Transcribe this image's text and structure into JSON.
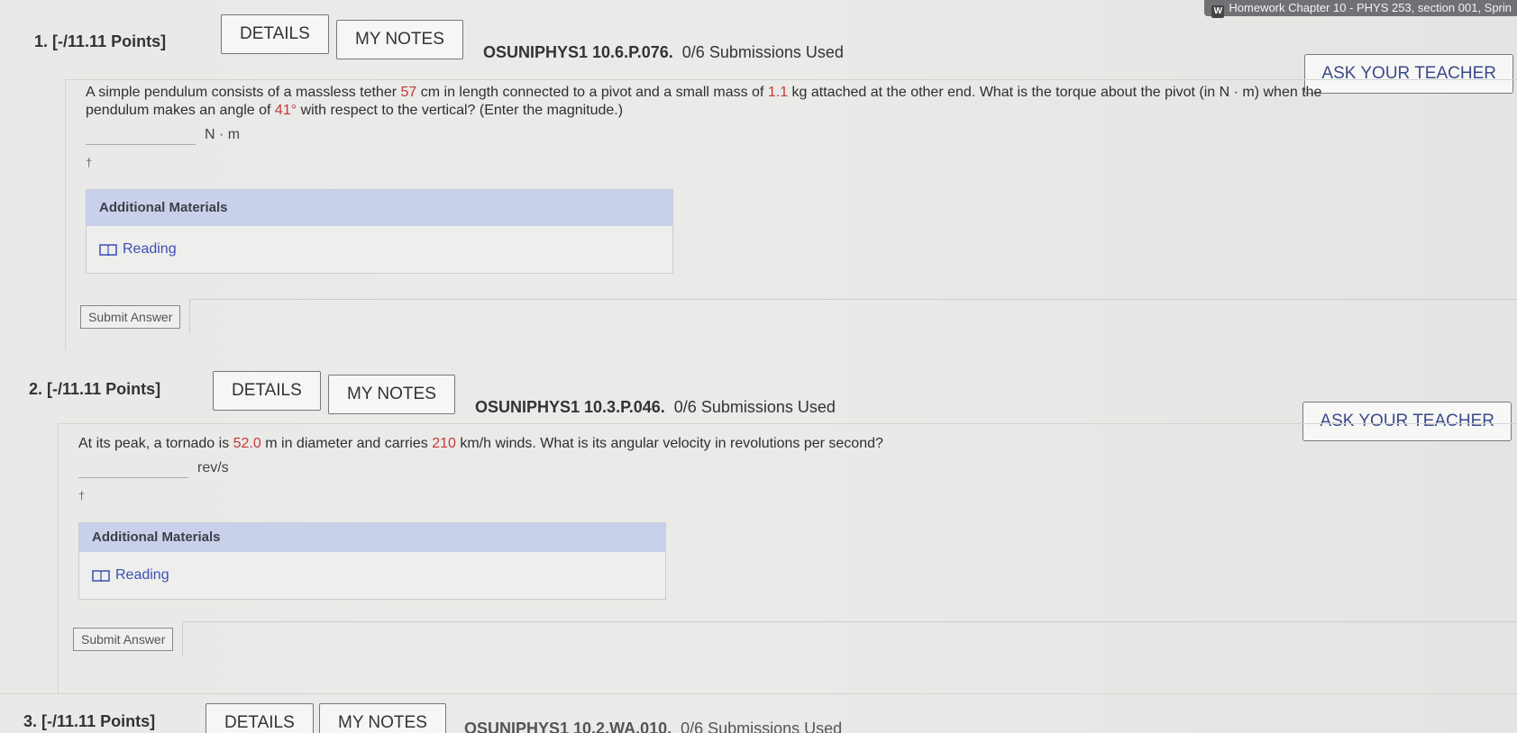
{
  "tab_title": "Homework Chapter 10 - PHYS 253, section 001, Sprin",
  "questions": [
    {
      "number": "1.",
      "points": "[-/11.11 Points]",
      "details_label": "DETAILS",
      "notes_label": "MY NOTES",
      "code": "OSUNIPHYS1 10.6.P.076.",
      "submissions": "0/6 Submissions Used",
      "ask_label": "ASK YOUR TEACHER",
      "prompt": {
        "t1": "A simple pendulum consists of a massless tether ",
        "v1": "57",
        "t2": " cm in length connected to a pivot and a small mass of ",
        "v2": "1.1",
        "t3": " kg attached at the other end. What is the torque about the pivot (in N · m) when the pendulum makes an angle of ",
        "v3": "41°",
        "t4": " with respect to the vertical? (Enter the magnitude.)"
      },
      "unit": "N · m",
      "dagger": "†",
      "materials_title": "Additional Materials",
      "reading_label": "Reading",
      "submit_label": "Submit Answer"
    },
    {
      "number": "2.",
      "points": "[-/11.11 Points]",
      "details_label": "DETAILS",
      "notes_label": "MY NOTES",
      "code": "OSUNIPHYS1 10.3.P.046.",
      "submissions": "0/6 Submissions Used",
      "ask_label": "ASK YOUR TEACHER",
      "prompt": {
        "t1": "At its peak, a tornado is ",
        "v1": "52.0",
        "t2": " m in diameter and carries ",
        "v2": "210",
        "t3": " km/h winds. What is its angular velocity in revolutions per second?"
      },
      "unit": "rev/s",
      "dagger": "†",
      "materials_title": "Additional Materials",
      "reading_label": "Reading",
      "submit_label": "Submit Answer"
    },
    {
      "number": "3.",
      "points": "[-/11.11 Points]",
      "details_label": "DETAILS",
      "notes_label": "MY NOTES",
      "code": "OSUNIPHYS1 10.2.WA.010.",
      "submissions": "0/6 Submissions Used"
    }
  ]
}
